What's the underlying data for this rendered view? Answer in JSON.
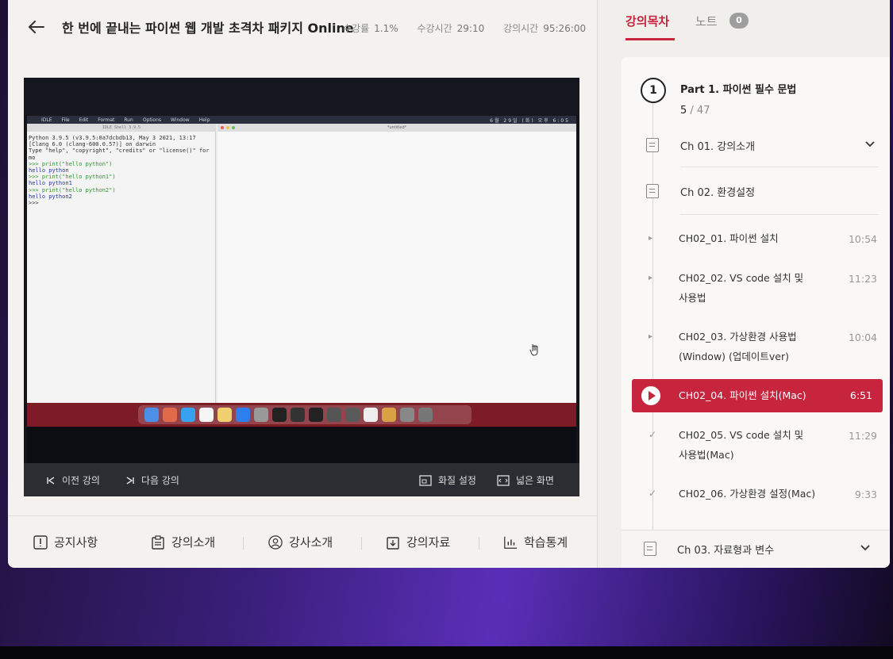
{
  "header": {
    "title": "한 번에 끝내는 파이썬 웹 개발 초격차 패키지 Online",
    "stats": [
      {
        "label": "수강률",
        "value": "1.1%"
      },
      {
        "label": "수강시간",
        "value": "29:10"
      },
      {
        "label": "강의시간",
        "value": "95:26:00"
      }
    ]
  },
  "video": {
    "shell_title": "IDLE Shell 3.9.5",
    "editor_title": "*untitled*",
    "menubar": [
      "IDLE",
      "File",
      "Edit",
      "Format",
      "Run",
      "Options",
      "Window",
      "Help"
    ],
    "menubar_right": "6월 29일 (화) 오후 6:05",
    "shell_lines": [
      "Python 3.9.5 (v3.9.5:0a7dcbdb13, May  3 2021, 13:17",
      "[Clang 6.0 (clang-600.0.57)] on darwin",
      "Type \"help\", \"copyright\", \"credits\" or \"license()\" for mo",
      ">>> print(\"hello python\")",
      "hello python",
      ">>> print(\"hello python1\")",
      "hello python1",
      ">>> print(\"hello python2\")",
      "hello python2",
      ">>>"
    ],
    "controls": {
      "prev": "이전 강의",
      "next": "다음 강의",
      "quality": "화질 설정",
      "wide": "넓은 화면"
    }
  },
  "bottom_tabs": [
    "공지사항",
    "강의소개",
    "강사소개",
    "강의자료",
    "학습통계"
  ],
  "sidebar": {
    "tab_active": "강의목차",
    "tab_note": "노트",
    "note_count": "0",
    "part": {
      "number": "1",
      "title": "Part 1. 파이썬 필수 문법",
      "progress_done": "5",
      "progress_total": "/ 47"
    },
    "chapters": [
      {
        "label": "Ch 01. 강의소개"
      },
      {
        "label": "Ch 02. 환경설정"
      }
    ],
    "lessons": [
      {
        "title": "CH02_01. 파이썬 설치",
        "duration": "10:54",
        "state": "none"
      },
      {
        "title": "CH02_02. VS code 설치 및 사용법",
        "duration": "11:23",
        "state": "none"
      },
      {
        "title": "CH02_03. 가상환경 사용법 (Window) (업데이트ver)",
        "duration": "10:04",
        "state": "none"
      },
      {
        "title": "CH02_04. 파이썬 설치(Mac)",
        "duration": "6:51",
        "state": "playing"
      },
      {
        "title": "CH02_05. VS code 설치 및 사용법(Mac)",
        "duration": "11:29",
        "state": "done"
      },
      {
        "title": "CH02_06. 가상환경 설정(Mac)",
        "duration": "9:33",
        "state": "done"
      }
    ],
    "footer_chapter": "Ch 03. 자료형과 변수",
    "colors": {
      "accent": "#c7253e"
    }
  }
}
